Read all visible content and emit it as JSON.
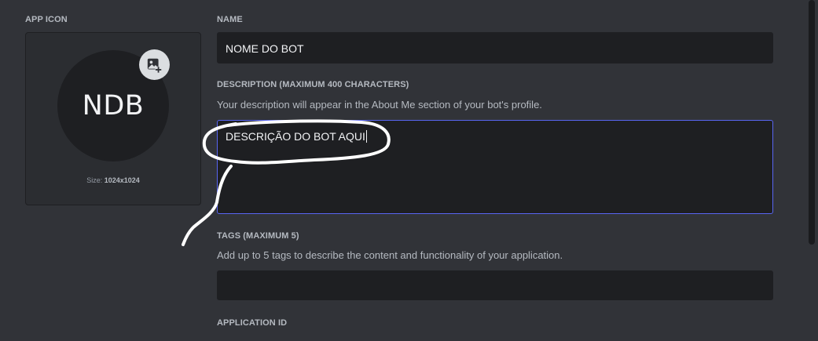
{
  "app_icon": {
    "label": "APP ICON",
    "initials": "NDB",
    "size_prefix": "Size:",
    "size_value": "1024x1024",
    "upload_icon": "image-add-icon"
  },
  "name": {
    "label": "NAME",
    "value": "NOME DO BOT"
  },
  "description": {
    "label": "DESCRIPTION (MAXIMUM 400 CHARACTERS)",
    "helper": "Your description will appear in the About Me section of your bot's profile.",
    "value": "DESCRIÇÃO DO BOT AQUI"
  },
  "tags": {
    "label": "TAGS (MAXIMUM 5)",
    "helper": "Add up to 5 tags to describe the content and functionality of your application.",
    "value": ""
  },
  "application_id": {
    "label": "APPLICATION ID"
  },
  "colors": {
    "background": "#313338",
    "input_bg": "#1e1f22",
    "focus_border": "#5865f2",
    "annotation_stroke": "#ffffff"
  }
}
